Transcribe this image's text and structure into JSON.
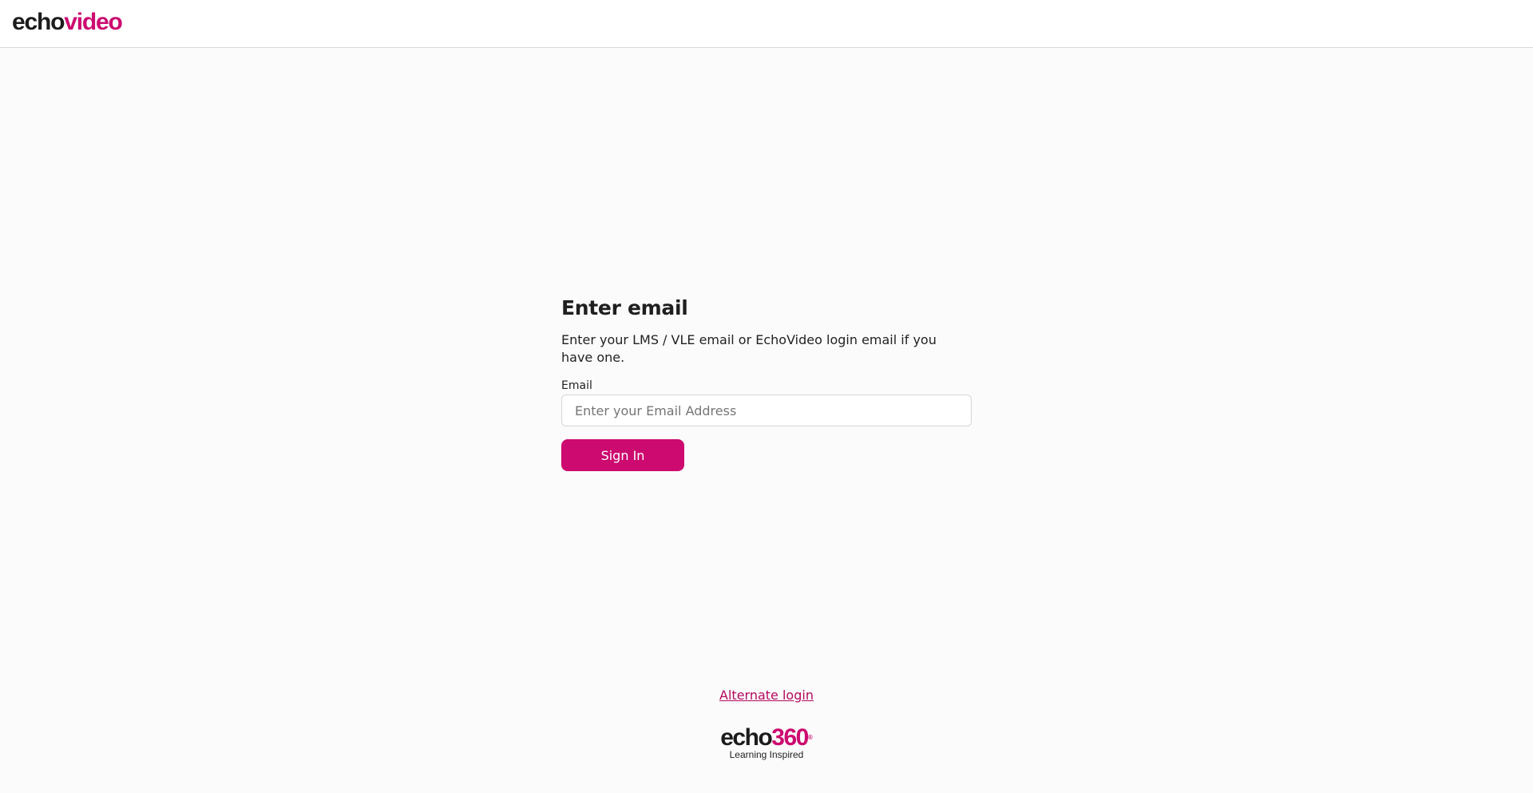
{
  "header": {
    "logo_part1": "echo",
    "logo_part2": "video"
  },
  "form": {
    "title": "Enter email",
    "description": "Enter your LMS / VLE email or EchoVideo login email if you have one.",
    "email_label": "Email",
    "email_value": "",
    "email_placeholder": "Enter your Email Address",
    "submit_label": "Sign In"
  },
  "alternate_login": "Alternate login",
  "footer": {
    "brand_part1": "echo",
    "brand_part2": "360",
    "trademark": "®",
    "tagline": "Learning Inspired"
  },
  "colors": {
    "brand_accent": "#cc0a6f",
    "link": "#b4085f",
    "background": "#fbfbfb"
  }
}
